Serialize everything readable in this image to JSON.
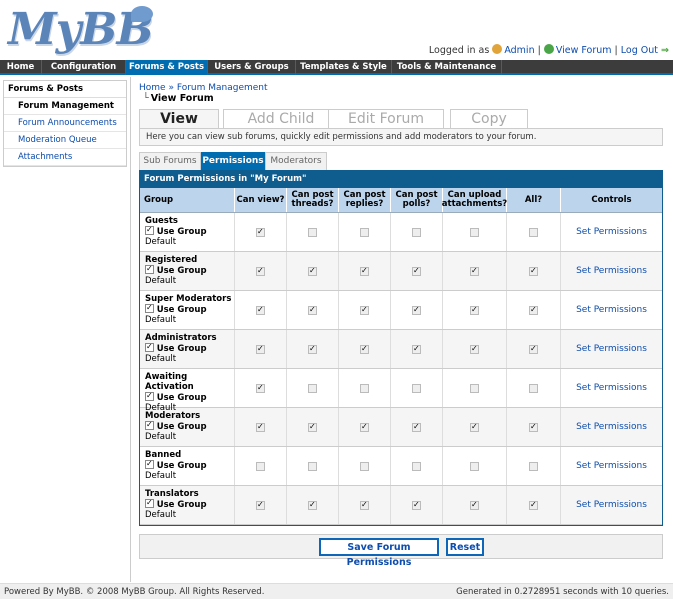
{
  "header": {
    "logo_text": "MyBB",
    "logged_in_as": "Logged in as",
    "user": "Admin",
    "view_forum": "View Forum",
    "logout": "Log Out"
  },
  "nav": {
    "items": [
      "Home",
      "Configuration",
      "Forums & Posts",
      "Users & Groups",
      "Templates & Style",
      "Tools & Maintenance"
    ],
    "active": "Forums & Posts"
  },
  "sidebar": {
    "title": "Forums & Posts",
    "items": [
      "Forum Management",
      "Forum Announcements",
      "Moderation Queue",
      "Attachments"
    ],
    "active": "Forum Management"
  },
  "breadcrumb": {
    "home": "Home",
    "sep": "»",
    "section": "Forum Management",
    "current": "View Forum"
  },
  "big_tabs": [
    "View Forum",
    "Add Child Forum",
    "Edit Forum Settings",
    "Copy Forum"
  ],
  "description": "Here you can view sub forums, quickly edit permissions and add moderators to your forum.",
  "small_tabs": [
    "Sub Forums",
    "Permissions",
    "Moderators"
  ],
  "table": {
    "title": "Forum Permissions in \"My Forum\"",
    "headers": [
      "Group",
      "Can view?",
      "Can post threads?",
      "Can post replies?",
      "Can post polls?",
      "Can upload attachments?",
      "All?",
      "Controls"
    ],
    "use_group_default_a": "Use Group",
    "use_group_default_b": "Default",
    "control_label": "Set Permissions",
    "rows": [
      {
        "group": "Guests",
        "perms": [
          true,
          false,
          false,
          false,
          false,
          false
        ]
      },
      {
        "group": "Registered",
        "perms": [
          true,
          true,
          true,
          true,
          true,
          true
        ]
      },
      {
        "group": "Super Moderators",
        "perms": [
          true,
          true,
          true,
          true,
          true,
          true
        ]
      },
      {
        "group": "Administrators",
        "perms": [
          true,
          true,
          true,
          true,
          true,
          true
        ]
      },
      {
        "group": "Awaiting Activation",
        "perms": [
          true,
          false,
          false,
          false,
          false,
          false
        ]
      },
      {
        "group": "Moderators",
        "perms": [
          true,
          true,
          true,
          true,
          true,
          true
        ]
      },
      {
        "group": "Banned",
        "perms": [
          false,
          false,
          false,
          false,
          false,
          false
        ]
      },
      {
        "group": "Translators",
        "perms": [
          true,
          true,
          true,
          true,
          true,
          true
        ]
      }
    ]
  },
  "buttons": {
    "save": "Save Forum Permissions",
    "reset": "Reset"
  },
  "footer": {
    "left": "Powered By MyBB. © 2008 MyBB Group. All Rights Reserved.",
    "right": "Generated in 0.2728951 seconds with 10 queries."
  }
}
